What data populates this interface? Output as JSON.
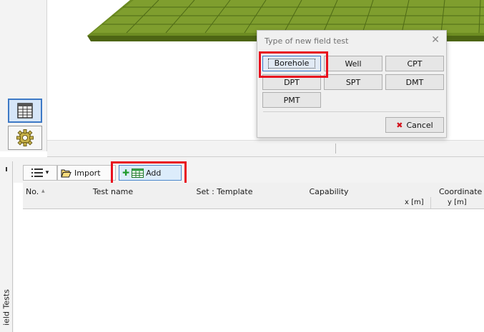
{
  "dialog": {
    "title": "Type of new field test",
    "close_glyph": "✕",
    "buttons": [
      "Borehole",
      "Well",
      "CPT",
      "DPT",
      "SPT",
      "DMT",
      "PMT"
    ],
    "cancel_label": "Cancel",
    "cancel_glyph": "✖"
  },
  "toolbar": {
    "import_label": "Import",
    "add_label": "Add",
    "add_glyph": "✚",
    "list_caret": "▾"
  },
  "table": {
    "columns": [
      "No.",
      "Test name",
      "Set : Template",
      "Capability"
    ],
    "sort_glyph": "▲",
    "coordinates_header": "Coordinate",
    "sub_columns": [
      "x [m]",
      "y [m]"
    ]
  },
  "panel": {
    "vertical_label": "ield Tests"
  },
  "colors": {
    "ground": "#7a9a2a",
    "highlight": "#e8101e",
    "accent": "#3d79c6"
  }
}
